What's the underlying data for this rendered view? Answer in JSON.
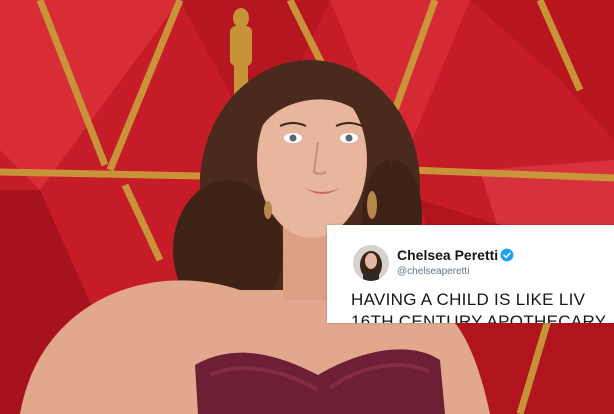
{
  "tweet": {
    "display_name": "Chelsea Peretti",
    "handle": "@chelseaperetti",
    "text_line_1": "HAVING A CHILD IS LIKE LIV",
    "text_line_2": "16TH CENTURY APOTHECARY",
    "verified_icon": "verified-badge-icon",
    "verified_color": "#1da1f2"
  },
  "colors": {
    "carpet_red": "#c81e2a",
    "gold_trim": "#c99a3a",
    "dress": "#6e1e35",
    "hair": "#4a2a1c"
  }
}
